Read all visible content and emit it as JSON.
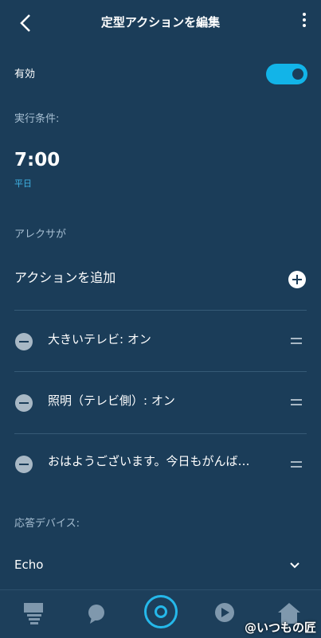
{
  "header": {
    "title": "定型アクションを編集",
    "back_icon": "back-arrow-icon",
    "more_icon": "more-vert-icon"
  },
  "enabled": {
    "label": "有効",
    "toggle_on": true,
    "accent_color": "#12b4e8"
  },
  "trigger": {
    "section_label": "実行条件:",
    "time": "7:00",
    "days": "平日"
  },
  "actions": {
    "section_label": "アレクサが",
    "add_label": "アクションを追加",
    "items": [
      {
        "label": "大きいテレビ: オン"
      },
      {
        "label": "照明（テレビ側）: オン"
      },
      {
        "label": "おはようございます。今日もがんば…"
      }
    ]
  },
  "response_device": {
    "section_label": "応答デバイス:",
    "value": "Echo"
  },
  "bottom_nav": [
    "home-icon",
    "chat-icon",
    "alexa-icon",
    "play-icon",
    "devices-icon"
  ],
  "watermark": "@いつもの匠",
  "colors": {
    "background": "#1b3d59",
    "accent": "#12b4e8",
    "muted": "#a6bed1"
  }
}
